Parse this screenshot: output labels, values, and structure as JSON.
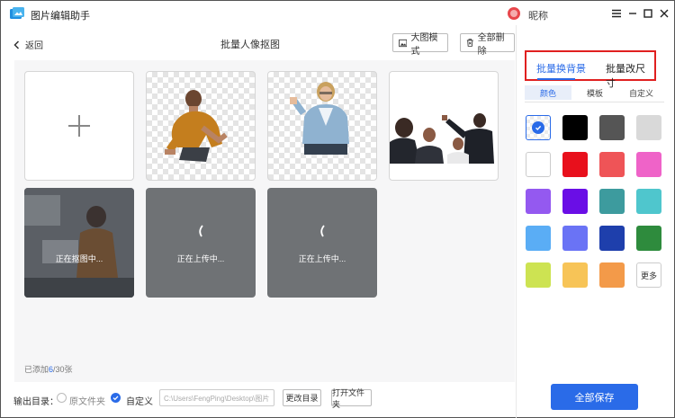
{
  "app": {
    "title": "图片编辑助手",
    "nickname": "昵称"
  },
  "header": {
    "back_label": "返回",
    "page_title": "批量人像抠图",
    "big_view_label": "大图模式",
    "delete_all_label": "全部删除"
  },
  "tiles": [
    {
      "kind": "add"
    },
    {
      "kind": "cutout",
      "subject": "man-in-yellow-shirt"
    },
    {
      "kind": "cutout",
      "subject": "woman-in-denim-shirt"
    },
    {
      "kind": "photo",
      "subject": "meeting-group"
    },
    {
      "kind": "processing",
      "status": "正在抠图中..."
    },
    {
      "kind": "uploading",
      "status": "正在上传中..."
    },
    {
      "kind": "uploading",
      "status": "正在上传中..."
    }
  ],
  "counter": {
    "prefix": "已添加",
    "current": "6",
    "total": "/30张"
  },
  "output": {
    "label": "输出目录：",
    "option_original": "原文件夹",
    "option_custom": "自定义",
    "path_value": "C:\\Users\\FengPing\\Desktop\\图片",
    "change_dir_label": "更改目录",
    "open_folder_label": "打开文件夹"
  },
  "right_panel": {
    "mode_tabs": [
      {
        "label": "批量换背景",
        "active": true
      },
      {
        "label": "批量改尺寸",
        "active": false
      }
    ],
    "sub_tabs": [
      {
        "label": "颜色",
        "active": true
      },
      {
        "label": "模板",
        "active": false
      },
      {
        "label": "自定义",
        "active": false
      }
    ],
    "swatches": [
      {
        "color": "transparent",
        "selected": true
      },
      {
        "color": "#000000"
      },
      {
        "color": "#555555"
      },
      {
        "color": "#d9d9d9"
      },
      {
        "color": "#ffffff"
      },
      {
        "color": "#e8101c"
      },
      {
        "color": "#ef5457"
      },
      {
        "color": "#ef63c8"
      },
      {
        "color": "#9459f0"
      },
      {
        "color": "#6a0ee6"
      },
      {
        "color": "#3d9b9e"
      },
      {
        "color": "#4fc6cd"
      },
      {
        "color": "#5aadf5"
      },
      {
        "color": "#6a73f5"
      },
      {
        "color": "#1e3fac"
      },
      {
        "color": "#2e8b3d"
      },
      {
        "color": "#cde352"
      },
      {
        "color": "#f7c457"
      },
      {
        "color": "#f39a49"
      }
    ],
    "more_label": "更多",
    "save_label": "全部保存"
  },
  "colors": {
    "accent": "#2a6be8",
    "highlight_border": "#e02020"
  }
}
